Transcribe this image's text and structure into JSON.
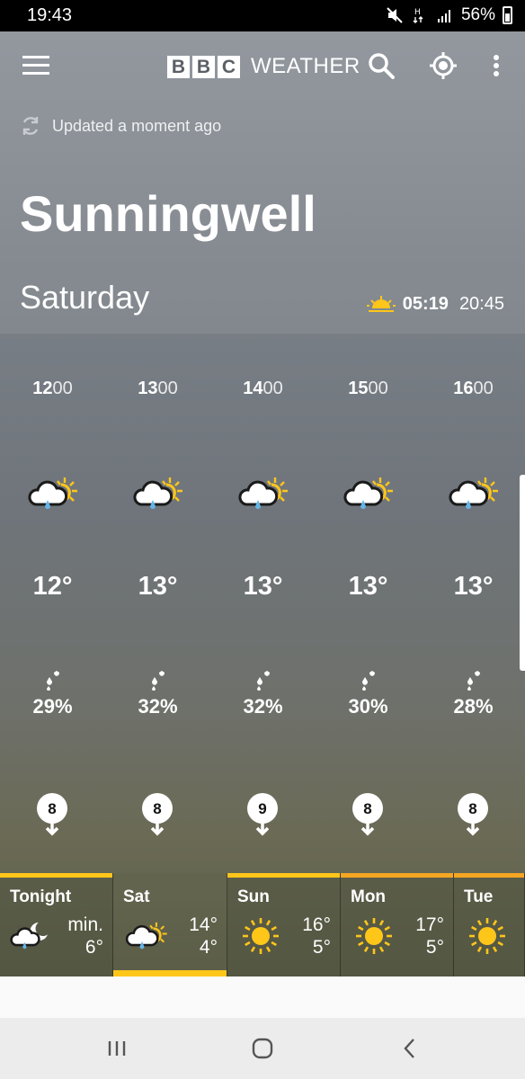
{
  "status_bar": {
    "time": "19:43",
    "battery": "56%"
  },
  "header": {
    "brand_boxes": [
      "B",
      "B",
      "C"
    ],
    "brand_word": "WEATHER",
    "updated": "Updated a moment ago",
    "location": "Sunningwell",
    "day": "Saturday",
    "sunrise": "05:19",
    "sunset": "20:45"
  },
  "hourly": [
    {
      "time_bold": "12",
      "time_rest": "00",
      "icon": "light-rain-sunny-intervals-icon",
      "temp": "12°",
      "rain": "29%",
      "wind": "8"
    },
    {
      "time_bold": "13",
      "time_rest": "00",
      "icon": "light-rain-sunny-intervals-icon",
      "temp": "13°",
      "rain": "32%",
      "wind": "8"
    },
    {
      "time_bold": "14",
      "time_rest": "00",
      "icon": "light-rain-sunny-intervals-icon",
      "temp": "13°",
      "rain": "32%",
      "wind": "9"
    },
    {
      "time_bold": "15",
      "time_rest": "00",
      "icon": "light-rain-sunny-intervals-icon",
      "temp": "13°",
      "rain": "30%",
      "wind": "8"
    },
    {
      "time_bold": "16",
      "time_rest": "00",
      "icon": "light-rain-sunny-intervals-icon",
      "temp": "13°",
      "rain": "28%",
      "wind": "8"
    }
  ],
  "daily": [
    {
      "name": "Tonight",
      "icon": "light-rain-moon-icon",
      "hi": "min.",
      "lo": "6°",
      "bar_color": "#ffc61a"
    },
    {
      "name": "Sat",
      "icon": "light-rain-sunny-intervals-icon",
      "hi": "14°",
      "lo": "4°",
      "bar_color": ""
    },
    {
      "name": "Sun",
      "icon": "sun-icon",
      "hi": "16°",
      "lo": "5°",
      "bar_color": "#ffc61a"
    },
    {
      "name": "Mon",
      "icon": "sun-icon",
      "hi": "17°",
      "lo": "5°",
      "bar_color": "#f5a623"
    },
    {
      "name": "Tue",
      "icon": "sun-icon",
      "hi": "",
      "lo": "",
      "bar_color": "#f5a623"
    }
  ],
  "colors": {
    "accent_yellow": "#ffc61a",
    "accent_orange": "#f5a623"
  }
}
